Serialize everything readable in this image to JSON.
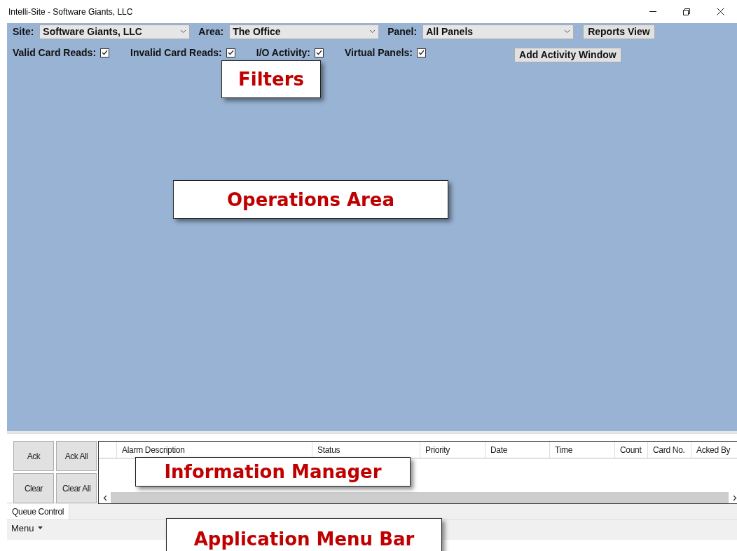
{
  "window": {
    "title": "Intelli-Site - Software Giants, LLC"
  },
  "selectors": [
    {
      "label": "Site:",
      "value": "Software Giants, LLC"
    },
    {
      "label": "Area:",
      "value": "The Office"
    },
    {
      "label": "Panel:",
      "value": "All Panels"
    }
  ],
  "top_buttons": [
    "Reports View",
    "Add Activity Window"
  ],
  "filters": [
    {
      "label": "Valid Card Reads:",
      "checked": true
    },
    {
      "label": "Invalid Card Reads:",
      "checked": true
    },
    {
      "label": "I/O Activity:",
      "checked": true
    },
    {
      "label": "Virtual Panels:",
      "checked": true
    }
  ],
  "queue_buttons": [
    "Ack",
    "Ack All",
    "Clear",
    "Clear All"
  ],
  "table": {
    "columns": [
      "Alarm Description",
      "Status",
      "Priority",
      "Date",
      "Time",
      "Count",
      "Card No.",
      "Acked By"
    ]
  },
  "tabs": [
    {
      "label": "Queue Control",
      "selected": true
    }
  ],
  "menu": {
    "label": "Menu"
  },
  "callouts": [
    {
      "text": "Filters"
    },
    {
      "text": "Operations Area"
    },
    {
      "text": "Information Manager"
    },
    {
      "text": "Application Menu Bar"
    }
  ]
}
